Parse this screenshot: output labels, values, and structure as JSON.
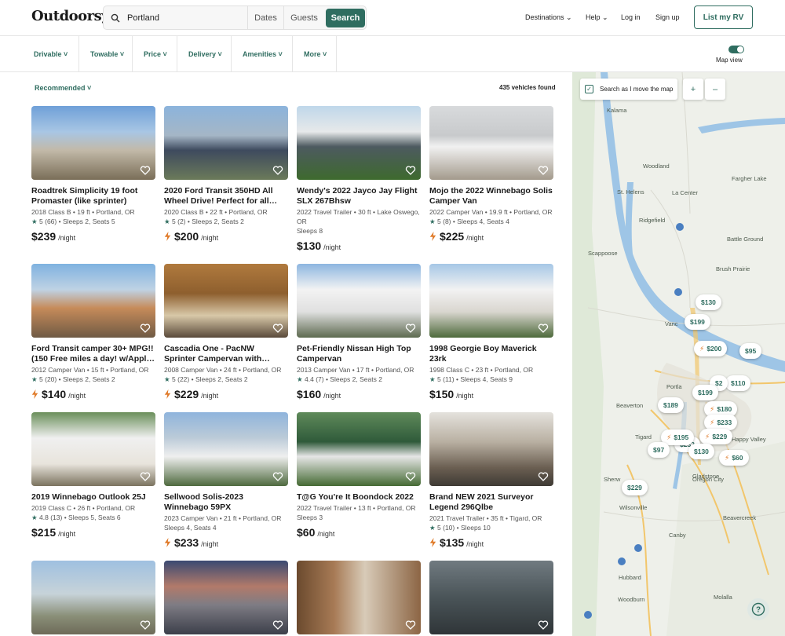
{
  "header": {
    "logo": "Outdoorsy",
    "search_location": "Portland",
    "dates_label": "Dates",
    "guests_label": "Guests",
    "search_button": "Search",
    "destinations": "Destinations",
    "help": "Help",
    "login": "Log in",
    "signup": "Sign up",
    "list_rv": "List my RV"
  },
  "filters": [
    "Drivable",
    "Towable",
    "Price",
    "Delivery",
    "Amenities",
    "More"
  ],
  "map_view_label": "Map view",
  "sort_label": "Recommended",
  "result_count": "435 vehicles found",
  "listings": [
    {
      "title": "Roadtrek Simplicity 19 foot Promaster (like sprinter)",
      "meta": "2018 Class B • 19 ft • Portland, OR",
      "rating": "5",
      "reviews": "(66)",
      "sleeps": "Sleeps 2, Seats 5",
      "price": "$239",
      "instant": false,
      "img": "1"
    },
    {
      "title": "2020 Ford Transit 350HD All Wheel Drive! Perfect for all…",
      "meta": "2020 Class B • 22 ft • Portland, OR",
      "rating": "5",
      "reviews": "(2)",
      "sleeps": "Sleeps 2, Seats 2",
      "price": "$200",
      "instant": true,
      "img": "2"
    },
    {
      "title": "Wendy's 2022 Jayco Jay Flight SLX 267Bhsw",
      "meta": "2022 Travel Trailer • 30 ft • Lake Oswego, OR",
      "rating": "",
      "reviews": "",
      "sleeps": "Sleeps 8",
      "price": "$130",
      "instant": false,
      "img": "3"
    },
    {
      "title": "Mojo the 2022 Winnebago Solis Camper Van",
      "meta": "2022 Camper Van • 19.9 ft • Portland, OR",
      "rating": "5",
      "reviews": "(8)",
      "sleeps": "Sleeps 4, Seats 4",
      "price": "$225",
      "instant": true,
      "img": "4"
    },
    {
      "title": "Ford Transit camper 30+ MPG!! (150 Free miles a day! w/Appl…",
      "meta": "2012 Camper Van • 15 ft • Portland, OR",
      "rating": "5",
      "reviews": "(20)",
      "sleeps": "Sleeps 2, Seats 2",
      "price": "$140",
      "instant": true,
      "img": "5"
    },
    {
      "title": "Cascadia One - PacNW Sprinter Campervan with…",
      "meta": "2008 Camper Van • 24 ft • Portland, OR",
      "rating": "5",
      "reviews": "(22)",
      "sleeps": "Sleeps 2, Seats 2",
      "price": "$229",
      "instant": true,
      "img": "6"
    },
    {
      "title": "Pet-Friendly Nissan High Top Campervan",
      "meta": "2013 Camper Van • 17 ft • Portland, OR",
      "rating": "4.4",
      "reviews": "(7)",
      "sleeps": "Sleeps 2, Seats 2",
      "price": "$160",
      "instant": false,
      "img": "7"
    },
    {
      "title": "1998 Georgie Boy Maverick 23rk",
      "meta": "1998 Class C • 23 ft • Portland, OR",
      "rating": "5",
      "reviews": "(11)",
      "sleeps": "Sleeps 4, Seats 9",
      "price": "$150",
      "instant": false,
      "img": "8"
    },
    {
      "title": "2019 Winnebago Outlook 25J",
      "meta": "2019 Class C • 26 ft • Portland, OR",
      "rating": "4.8",
      "reviews": "(13)",
      "sleeps": "Sleeps 5, Seats 6",
      "price": "$215",
      "instant": false,
      "img": "9"
    },
    {
      "title": "Sellwood Solis-2023 Winnebago 59PX",
      "meta": "2023 Camper Van • 21 ft • Portland, OR",
      "rating": "",
      "reviews": "",
      "sleeps": "Sleeps 4, Seats 4",
      "price": "$233",
      "instant": true,
      "img": "10"
    },
    {
      "title": "T@G You're It Boondock 2022",
      "meta": "2022 Travel Trailer • 13 ft • Portland, OR",
      "rating": "",
      "reviews": "",
      "sleeps": "Sleeps 3",
      "price": "$60",
      "instant": false,
      "img": "11"
    },
    {
      "title": "Brand NEW 2021 Surveyor Legend 296Qlbe",
      "meta": "2021 Travel Trailer • 35 ft • Tigard, OR",
      "rating": "5",
      "reviews": "(10)",
      "sleeps": "Sleeps 10",
      "price": "$135",
      "instant": true,
      "img": "12"
    }
  ],
  "price_unit": "/night",
  "map": {
    "search_as_move": "Search as I move the map",
    "zoom_in": "+",
    "zoom_out": "–",
    "pins": [
      {
        "label": "$130",
        "instant": false
      },
      {
        "label": "$199",
        "instant": false
      },
      {
        "label": "$200",
        "instant": true
      },
      {
        "label": "$95",
        "instant": false
      },
      {
        "label": "$110",
        "instant": false
      },
      {
        "label": "$2",
        "instant": false
      },
      {
        "label": "$199",
        "instant": false
      },
      {
        "label": "$189",
        "instant": false
      },
      {
        "label": "$180",
        "instant": true
      },
      {
        "label": "$233",
        "instant": true
      },
      {
        "label": "$229",
        "instant": true
      },
      {
        "label": "$232",
        "instant": false
      },
      {
        "label": "$195",
        "instant": true
      },
      {
        "label": "$97",
        "instant": false
      },
      {
        "label": "$130",
        "instant": false
      },
      {
        "label": "$60",
        "instant": true
      },
      {
        "label": "$229",
        "instant": false
      }
    ],
    "places": [
      "Kalama",
      "Woodland",
      "Fargher Lake",
      "St. Helens",
      "La Center",
      "Ridgefield",
      "Battle Ground",
      "Scappoose",
      "Brush Prairie",
      "Vanc",
      "Portla",
      "Beaverton",
      "Tigard",
      "Happy Valley",
      "Gladstone",
      "Sherw",
      "Oregon City",
      "Wilsonville",
      "Beavercreek",
      "Canby",
      "Hubbard",
      "Woodburn",
      "Molalla"
    ]
  }
}
